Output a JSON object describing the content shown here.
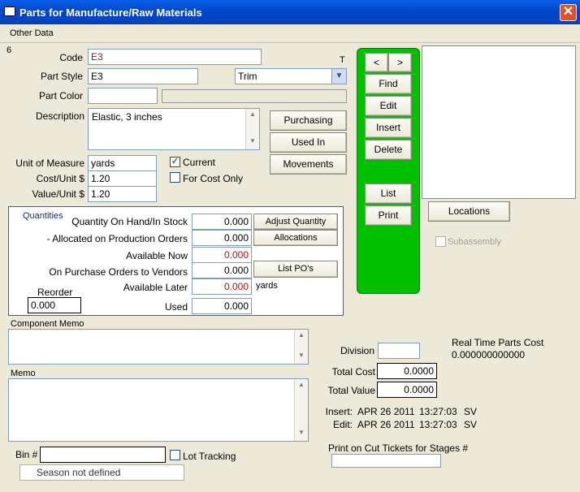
{
  "window": {
    "title": "Parts for Manufacture/Raw Materials",
    "close_glyph": "✕"
  },
  "menu": {
    "other_data": "Other Data"
  },
  "record_number": "6",
  "t_marker": "T",
  "fields": {
    "code_label": "Code",
    "code_value": "E3",
    "part_style_label": "Part Style",
    "part_style_value": "E3",
    "style_type_value": "Trim",
    "part_color_label": "Part Color",
    "part_color_value": "",
    "description_label": "Description",
    "description_value": "Elastic, 3 inches",
    "unit_label": "Unit of Measure",
    "unit_value": "yards",
    "cost_label": "Cost/Unit $",
    "cost_value": "1.20",
    "valueunit_label": "Value/Unit $",
    "valueunit_value": "1.20",
    "current_label": "Current",
    "current_checked": "✓",
    "costonly_label": "For Cost Only"
  },
  "side_buttons": {
    "purchasing": "Purchasing",
    "used_in": "Used In",
    "movements": "Movements"
  },
  "nav": {
    "prev": "<",
    "next": ">",
    "find": "Find",
    "edit": "Edit",
    "insert": "Insert",
    "delete": "Delete",
    "list": "List",
    "print": "Print"
  },
  "locations_button": "Locations",
  "subassembly_label": "Subassembly",
  "quantities": {
    "title": "Quantities",
    "on_hand_label": "Quantity On Hand/In Stock",
    "on_hand_value": "0.000",
    "allocated_label": "- Allocated on Production Orders",
    "allocated_value": "0.000",
    "available_now_label": "Available Now",
    "available_now_value": "0.000",
    "on_po_label": "On Purchase Orders to Vendors",
    "on_po_value": "0.000",
    "available_later_label": "Available Later",
    "available_later_value": "0.000",
    "used_label": "Used",
    "used_value": "0.000",
    "reorder_label": "Reorder",
    "reorder_value": "0.000",
    "unit_text": "yards",
    "adjust_button": "Adjust Quantity",
    "allocations_button": "Allocations",
    "list_pos_button": "List PO's"
  },
  "component_memo_label": "Component Memo",
  "memo_label": "Memo",
  "bin_label": "Bin #",
  "bin_value": "",
  "lot_tracking_label": "Lot Tracking",
  "season_value": "Season not defined",
  "division_label": "Division",
  "division_value": "",
  "real_time_label": "Real Time Parts Cost",
  "real_time_value": "0.000000000000",
  "total_cost_label": "Total Cost",
  "total_cost_value": "0.0000",
  "total_value_label": "Total Value",
  "total_value_value": "0.0000",
  "insert_label": "Insert:",
  "insert_date": "APR 26 2011",
  "insert_time": "13:27:03",
  "insert_user": "SV",
  "edit_label": "Edit:",
  "edit_date": "APR 26 2011",
  "edit_time": "13:27:03",
  "edit_user": "SV",
  "print_stages_label": "Print on Cut Tickets for Stages #",
  "print_stages_value": ""
}
